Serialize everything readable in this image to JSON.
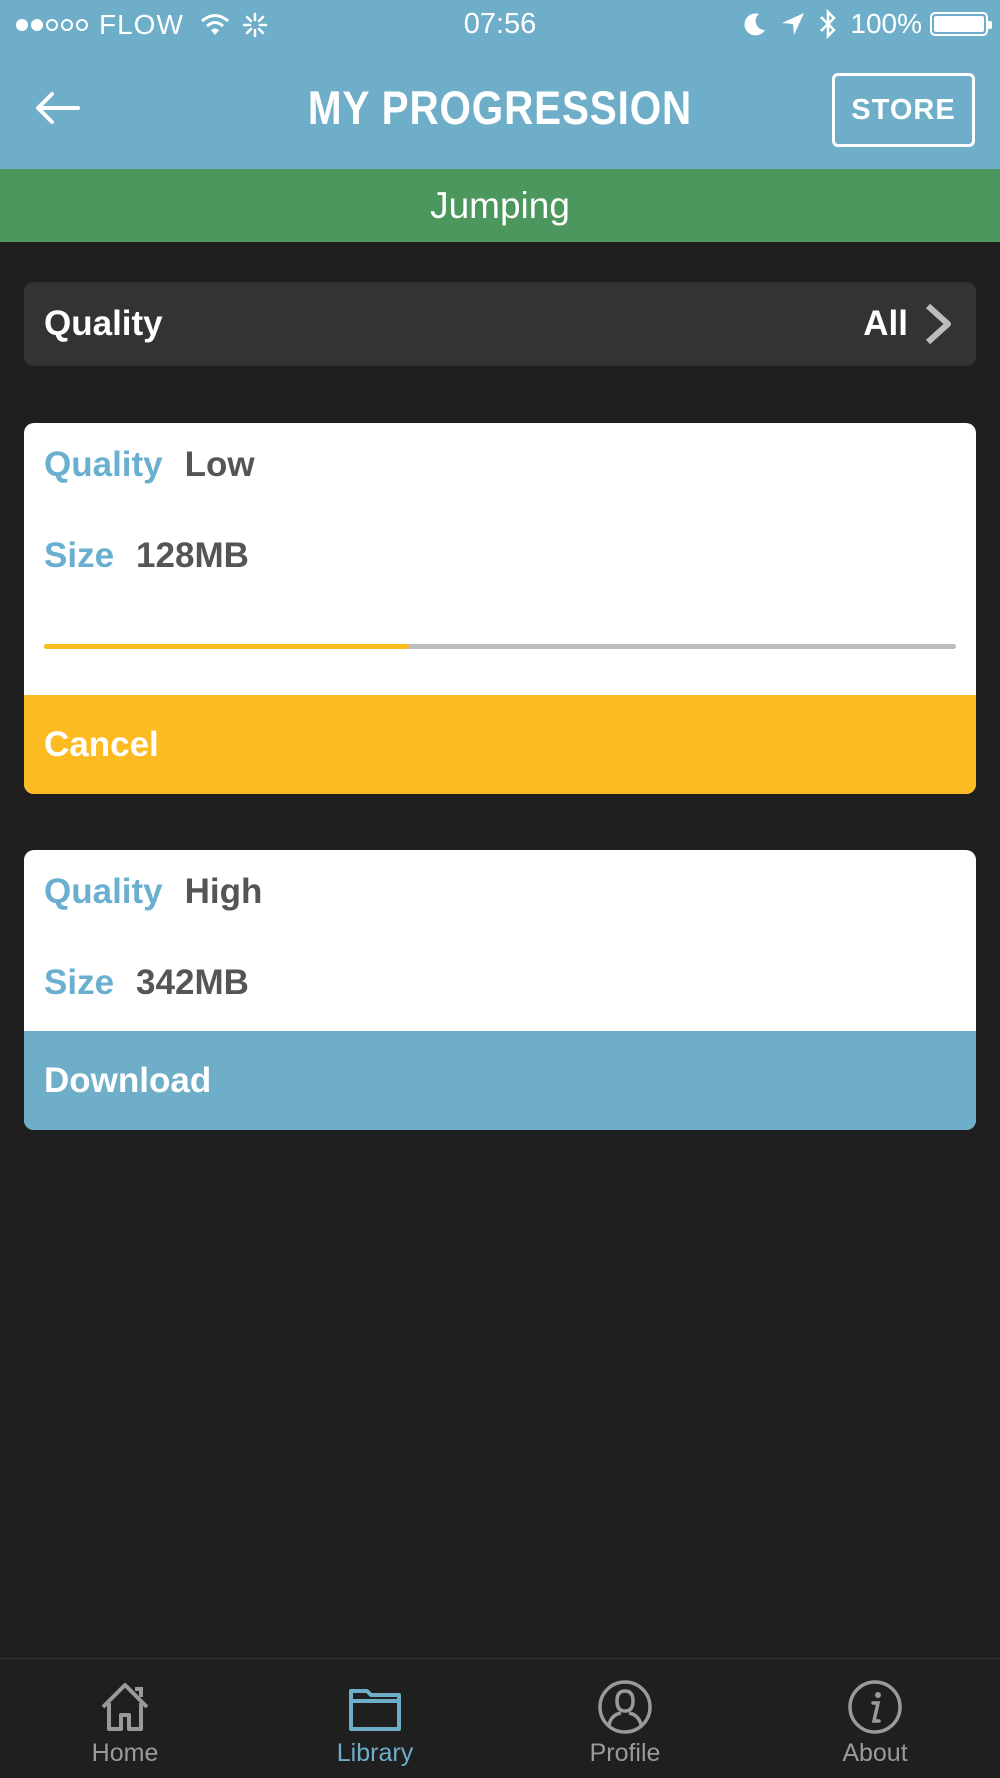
{
  "status_bar": {
    "carrier": "FLOW",
    "signal_filled": 2,
    "signal_total": 5,
    "time": "07:56",
    "battery": "100%",
    "battery_level": 1.0
  },
  "header": {
    "title": "MY PROGRESSION",
    "store_label": "STORE",
    "back_icon": "back-arrow-icon",
    "color": "#6faec8"
  },
  "category": {
    "name": "Jumping",
    "color": "#4b975d"
  },
  "filter": {
    "label": "Quality",
    "value": "All",
    "icon": "chevron-right-icon"
  },
  "downloads": [
    {
      "quality_key": "Quality",
      "quality_value": "Low",
      "size_key": "Size",
      "size_value": "128MB",
      "progress": 0.4,
      "action_label": "Cancel",
      "action_color": "#fcbb22"
    },
    {
      "quality_key": "Quality",
      "quality_value": "High",
      "size_key": "Size",
      "size_value": "342MB",
      "action_label": "Download",
      "action_color": "#6faec8"
    }
  ],
  "tabbar": {
    "active": "Library",
    "tabs": [
      {
        "label": "Home",
        "icon": "home-icon"
      },
      {
        "label": "Library",
        "icon": "folder-icon"
      },
      {
        "label": "Profile",
        "icon": "profile-icon"
      },
      {
        "label": "About",
        "icon": "info-icon"
      }
    ]
  },
  "colors": {
    "background": "#1f1f1f",
    "accent_text": "#6aaed0",
    "progress_fill": "#fbbc22",
    "progress_track": "#bdbdbd"
  }
}
